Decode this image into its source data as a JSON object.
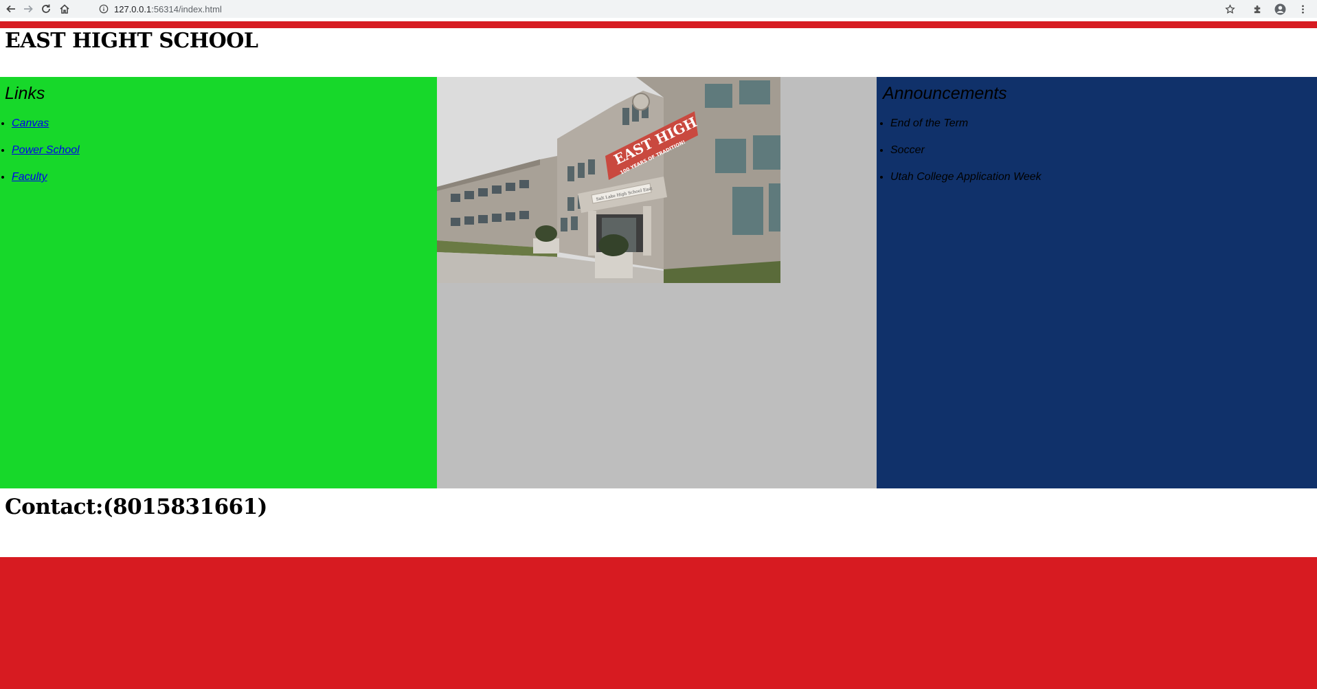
{
  "browser": {
    "url_host": "127.0.0.1",
    "url_rest": ":56314/index.html",
    "icons": [
      "back-arrow-icon",
      "forward-arrow-icon",
      "reload-icon",
      "home-icon",
      "info-icon",
      "star-icon",
      "extensions-icon",
      "profile-icon",
      "menu-icon"
    ]
  },
  "header": {
    "title": "EAST HIGHT SCHOOL"
  },
  "links": {
    "heading": "Links",
    "items": [
      {
        "label": "Canvas"
      },
      {
        "label": "Power School"
      },
      {
        "label": "Faculty"
      }
    ]
  },
  "photo": {
    "banner_line1": "EAST HIGH",
    "banner_line2": "100 YEARS OF TRADITION!",
    "entrance_sign": "Salt Lake High School East"
  },
  "announcements": {
    "heading": "Announcements",
    "items": [
      {
        "label": "End of the Term"
      },
      {
        "label": "Soccer"
      },
      {
        "label": "Utah College Application Week"
      }
    ]
  },
  "contact": {
    "text": "Contact:(8015831661)"
  },
  "colors": {
    "accent_red": "#d71b21",
    "links_green": "#17d82a",
    "middle_gray": "#bebebe",
    "announcements_navy": "#10316a"
  }
}
